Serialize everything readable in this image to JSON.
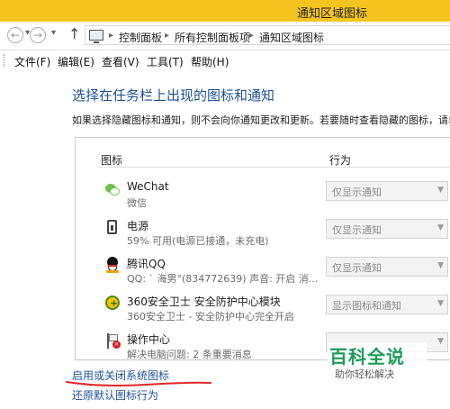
{
  "window": {
    "title": "通知区域图标"
  },
  "nav": {
    "breadcrumbs": [
      "控制面板",
      "所有控制面板项",
      "通知区域图标"
    ]
  },
  "menu": {
    "items": [
      "文件(F)",
      "编辑(E)",
      "查看(V)",
      "工具(T)",
      "帮助(H)"
    ]
  },
  "main": {
    "heading": "选择在任务栏上出现的图标和通知",
    "description": "如果选择隐藏图标和通知，则不会向你通知更改和更新。若要随时查看隐藏的图标，请单击",
    "columns": {
      "icon": "图标",
      "behavior": "行为"
    },
    "rows": [
      {
        "name": "WeChat",
        "sub": "微信",
        "behavior": "仅显示通知",
        "icon": "wechat-icon"
      },
      {
        "name": "电源",
        "sub": "59% 可用(电源已接通，未充电)",
        "behavior": "仅显示通知",
        "icon": "power-icon"
      },
      {
        "name": "腾讯QQ",
        "sub": "QQ: ` 海男°(834772639)  声音: 开启  消...",
        "behavior": "仅显示通知",
        "icon": "qq-icon"
      },
      {
        "name": "360安全卫士 安全防护中心模块",
        "sub": "360安全卫士 - 安全防护中心完全开启",
        "behavior": "显示图标和通知",
        "icon": "360-shield-icon"
      },
      {
        "name": "操作中心",
        "sub": "解决电脑问题: 2 条重要消息",
        "behavior": "",
        "icon": "action-center-flag-icon"
      }
    ],
    "links": {
      "system_icons": "启用或关闭系统图标",
      "restore_defaults": "还原默认图标行为"
    }
  },
  "watermark": {
    "main": "百科全说",
    "sub": "助你轻松解决"
  },
  "colors": {
    "titlebar": "#f6c41f",
    "heading": "#1d4f9b",
    "watermark": "#1d9c5a",
    "underline": "#e02828"
  }
}
